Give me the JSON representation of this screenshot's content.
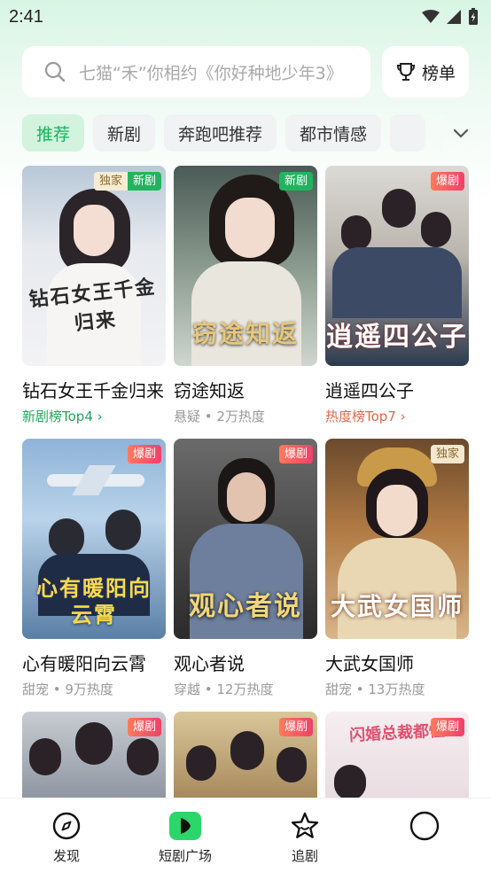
{
  "status_bar": {
    "time": "2:41"
  },
  "search": {
    "placeholder": "七猫“禾”你相约《你好种地少年3》"
  },
  "rank_button": {
    "label": "榜单"
  },
  "tabs": [
    {
      "label": "推荐",
      "active": true
    },
    {
      "label": "新剧",
      "active": false
    },
    {
      "label": "奔跑吧推荐",
      "active": false
    },
    {
      "label": "都市情感",
      "active": false
    }
  ],
  "dramas": [
    {
      "title": "钻石女王千金归来",
      "meta": "新剧榜Top4 ›",
      "badges": [
        "独家",
        "新剧"
      ],
      "poster_text": "钻石女王千金归来"
    },
    {
      "title": "窃途知返",
      "meta": "悬疑 • 2万热度",
      "badges": [
        "新剧"
      ],
      "poster_text": "窃途知返"
    },
    {
      "title": "逍遥四公子",
      "meta": "热度榜Top7 ›",
      "badges": [
        "爆剧"
      ],
      "poster_text": "逍遥四公子"
    },
    {
      "title": "心有暖阳向云霄",
      "meta": "甜宠 • 9万热度",
      "badges": [
        "爆剧"
      ],
      "poster_text": "心有暖阳向云霄"
    },
    {
      "title": "观心者说",
      "meta": "穿越 • 12万热度",
      "badges": [
        "爆剧"
      ],
      "poster_text": "观心者说"
    },
    {
      "title": "大武女国师",
      "meta": "甜宠 • 13万热度",
      "badges": [
        "独家"
      ],
      "poster_text": "大武女国师"
    },
    {
      "title": "",
      "meta": "",
      "badges": [
        "爆剧"
      ],
      "poster_text": ""
    },
    {
      "title": "",
      "meta": "",
      "badges": [
        "爆剧"
      ],
      "poster_text": ""
    },
    {
      "title": "",
      "meta": "",
      "badges": [
        "爆剧"
      ],
      "poster_text": "闪婚总裁都懂"
    }
  ],
  "bottom_nav": [
    {
      "label": "发现",
      "icon": "compass-icon"
    },
    {
      "label": "短剧广场",
      "icon": "play-icon",
      "active": true
    },
    {
      "label": "追剧",
      "icon": "star-icon"
    },
    {
      "label": "",
      "icon": "profile-icon"
    }
  ],
  "colors": {
    "accent": "#23b35f",
    "hot_badge": "#f2406a",
    "meta_red": "#e2664c"
  }
}
